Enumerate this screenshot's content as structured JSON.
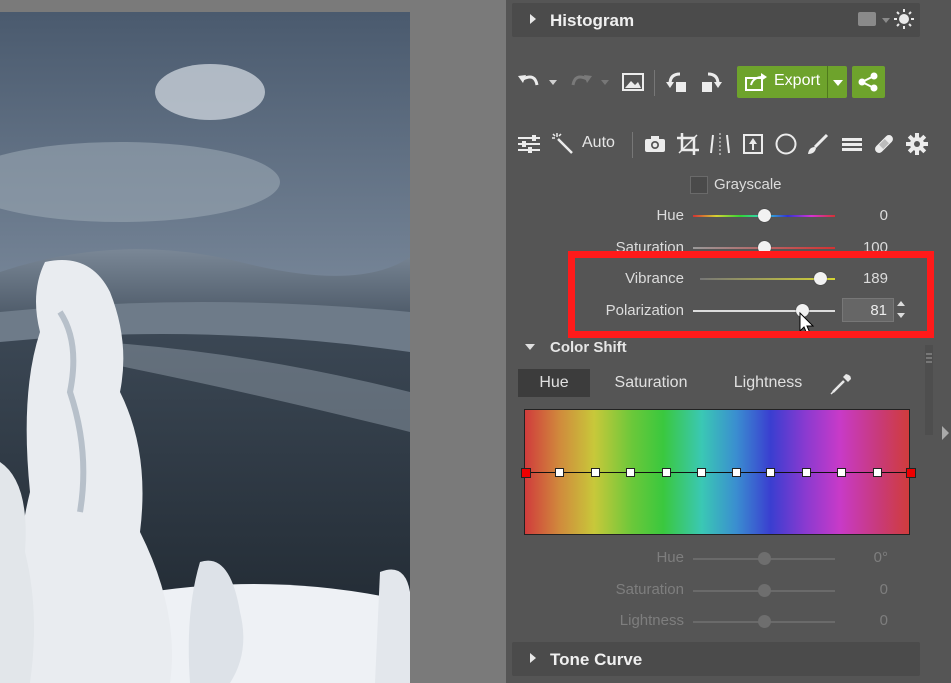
{
  "histogram": {
    "title": "Histogram"
  },
  "toolbar": {
    "export_label": "Export"
  },
  "tools": {
    "auto_label": "Auto"
  },
  "colors": {
    "grayscale_label": "Grayscale",
    "sliders": [
      {
        "label": "Hue",
        "value": "0",
        "level": 0.5
      },
      {
        "label": "Saturation",
        "value": "100",
        "level": 0.5
      },
      {
        "label": "Vibrance",
        "value": "189",
        "level": 0.87
      },
      {
        "label": "Polarization",
        "value": "81",
        "level": 0.77
      }
    ]
  },
  "color_shift": {
    "title": "Color Shift",
    "tabs": [
      "Hue",
      "Saturation",
      "Lightness"
    ],
    "active_tab": "Hue",
    "sliders": [
      {
        "label": "Hue",
        "value": "0°",
        "level": 0.5
      },
      {
        "label": "Saturation",
        "value": "0",
        "level": 0.5
      },
      {
        "label": "Lightness",
        "value": "0",
        "level": 0.5
      }
    ]
  },
  "tone_curve": {
    "title": "Tone Curve"
  },
  "accent": {
    "export_green": "#6ea32c",
    "highlight_red": "#ff1a1a"
  }
}
